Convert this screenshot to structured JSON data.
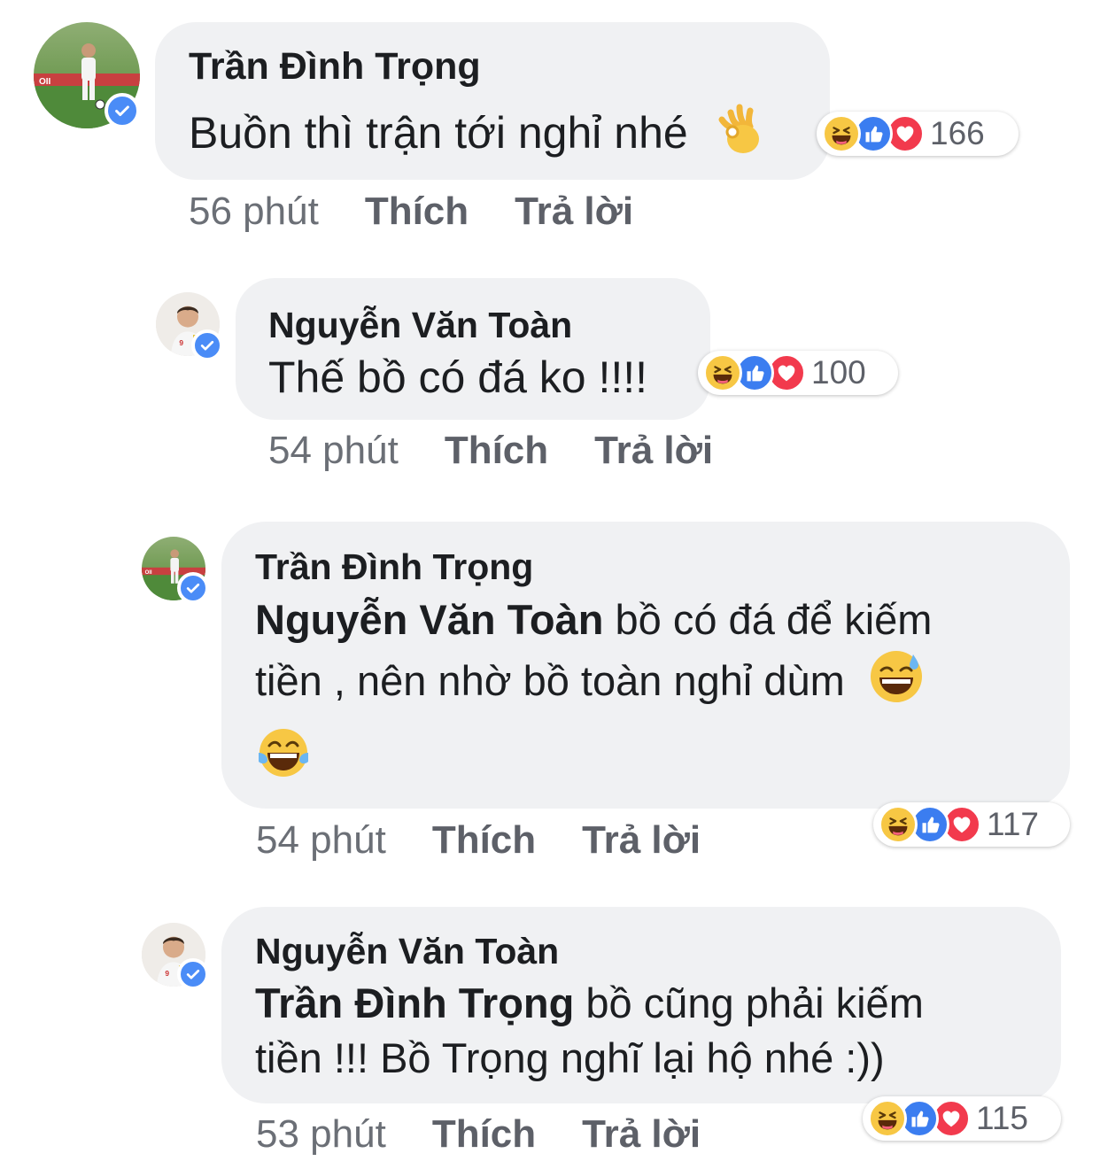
{
  "comments": [
    {
      "author": "Trần Đình Trọng",
      "text": "Buồn thì trận tới nghỉ nhé",
      "reactions": {
        "count": "166",
        "icons": [
          "haha-icon",
          "like-icon",
          "love-icon"
        ]
      },
      "time": "56 phút",
      "like_label": "Thích",
      "reply_label": "Trả lời"
    },
    {
      "author": "Nguyễn Văn Toàn",
      "text": "Thế bồ có đá ko !!!!",
      "reactions": {
        "count": "100",
        "icons": [
          "haha-icon",
          "like-icon",
          "love-icon"
        ]
      },
      "time": "54 phút",
      "like_label": "Thích",
      "reply_label": "Trả lời"
    },
    {
      "author": "Trần Đình Trọng",
      "mention": "Nguyễn Văn Toàn",
      "text_line1": "bồ có đá để kiếm",
      "text_line2": "tiền , nên nhờ bồ toàn nghỉ dùm",
      "reactions": {
        "count": "117",
        "icons": [
          "haha-icon",
          "like-icon",
          "love-icon"
        ]
      },
      "time": "54 phút",
      "like_label": "Thích",
      "reply_label": "Trả lời"
    },
    {
      "author": "Nguyễn Văn Toàn",
      "mention": "Trần Đình Trọng",
      "text_line1": "bồ cũng phải kiếm",
      "text_line2": "tiền !!! Bồ Trọng nghĩ lại hộ nhé :))",
      "reactions": {
        "count": "115",
        "icons": [
          "haha-icon",
          "like-icon",
          "love-icon"
        ]
      },
      "time": "53 phút",
      "like_label": "Thích",
      "reply_label": "Trả lời"
    }
  ],
  "colors": {
    "bubble": "#f0f1f3",
    "verified": "#4a8cf7",
    "like": "#3b7df0",
    "love": "#f23a4d",
    "haha": "#f7c744"
  }
}
